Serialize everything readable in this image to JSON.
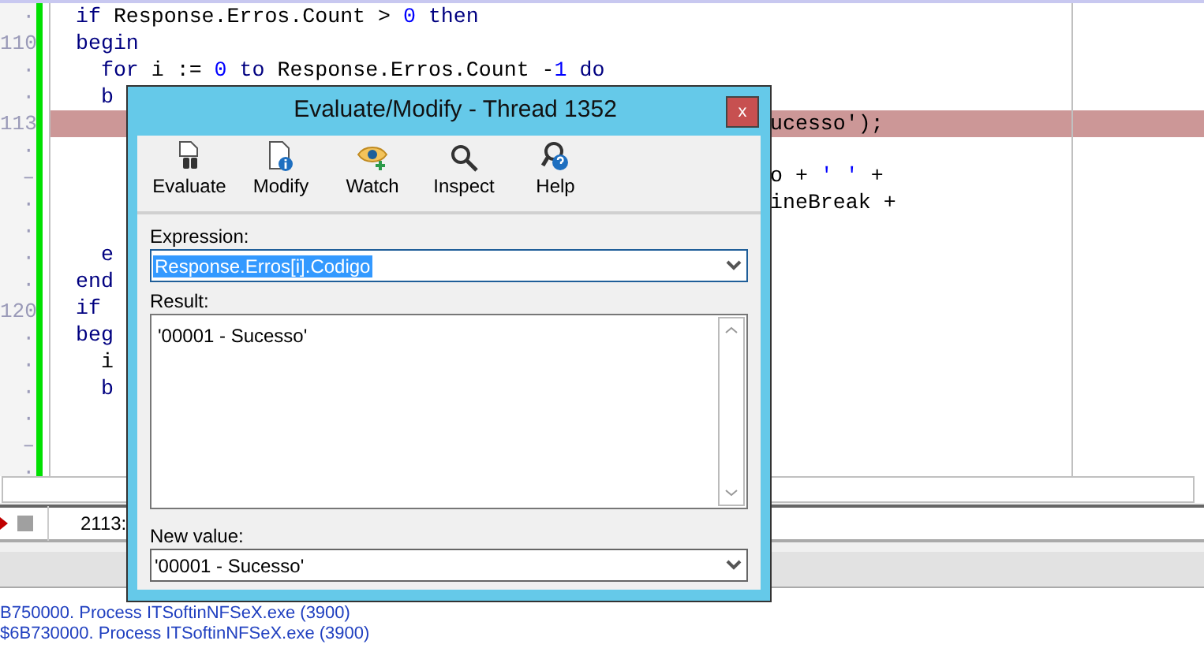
{
  "editor": {
    "lines": [
      {
        "gutter": "·",
        "highlighted": false,
        "left": [
          {
            "kind": "keyword",
            "text": "if"
          },
          {
            "kind": "plain",
            "text": " Response.Erros.Count > "
          },
          {
            "kind": "number",
            "text": "0"
          },
          {
            "kind": "keyword",
            "text": " then"
          }
        ]
      },
      {
        "gutter": "110",
        "highlighted": false,
        "left": [
          {
            "kind": "keyword",
            "text": "begin"
          }
        ]
      },
      {
        "gutter": "·",
        "highlighted": false,
        "left": [
          {
            "kind": "keyword",
            "text": "  for"
          },
          {
            "kind": "plain",
            "text": " i := "
          },
          {
            "kind": "number",
            "text": "0"
          },
          {
            "kind": "keyword",
            "text": " to"
          },
          {
            "kind": "plain",
            "text": " Response.Erros.Count -"
          },
          {
            "kind": "number",
            "text": "1"
          },
          {
            "kind": "keyword",
            "text": " do"
          }
        ]
      },
      {
        "gutter": "·",
        "highlighted": false,
        "left": [
          {
            "kind": "keyword",
            "text": "  b"
          }
        ]
      },
      {
        "gutter": "113",
        "highlighted": true,
        "right": [
          {
            "kind": "plain",
            "text": "ucesso');"
          }
        ]
      },
      {
        "gutter": "·",
        "highlighted": false
      },
      {
        "gutter": "–",
        "highlighted": false,
        "right": [
          {
            "kind": "plain",
            "text": "o + "
          },
          {
            "kind": "string",
            "text": "' '"
          },
          {
            "kind": "plain",
            "text": " +"
          }
        ]
      },
      {
        "gutter": "·",
        "highlighted": false,
        "right": [
          {
            "kind": "plain",
            "text": "ineBreak +"
          }
        ]
      },
      {
        "gutter": "·",
        "highlighted": false
      },
      {
        "gutter": "·",
        "highlighted": false,
        "left": [
          {
            "kind": "keyword",
            "text": "  e"
          }
        ]
      },
      {
        "gutter": "·",
        "highlighted": false,
        "left": [
          {
            "kind": "keyword",
            "text": "end"
          }
        ]
      },
      {
        "gutter": "120",
        "highlighted": false,
        "left": [
          {
            "kind": "keyword",
            "text": "if"
          }
        ]
      },
      {
        "gutter": "·",
        "highlighted": false,
        "left": [
          {
            "kind": "keyword",
            "text": "beg"
          }
        ]
      },
      {
        "gutter": "·",
        "highlighted": false,
        "left": [
          {
            "kind": "plain",
            "text": "  i"
          }
        ]
      },
      {
        "gutter": "·",
        "highlighted": false,
        "left": [
          {
            "kind": "keyword",
            "text": "  b"
          }
        ]
      },
      {
        "gutter": "·",
        "highlighted": false
      },
      {
        "gutter": "–",
        "highlighted": false
      },
      {
        "gutter": "·",
        "highlighted": false
      }
    ]
  },
  "status": {
    "position": "2113:"
  },
  "messages": [
    "B750000. Process ITSoftinNFSeX.exe (3900)",
    "$6B730000. Process ITSoftinNFSeX.exe (3900)"
  ],
  "dialog": {
    "title": "Evaluate/Modify - Thread 1352",
    "close": "x",
    "toolbar": [
      {
        "kind": "evaluate",
        "label": "Evaluate"
      },
      {
        "kind": "modify",
        "label": "Modify"
      },
      {
        "kind": "watch",
        "label": "Watch"
      },
      {
        "kind": "inspect",
        "label": "Inspect"
      },
      {
        "kind": "help",
        "label": "Help"
      }
    ],
    "expression": {
      "label": "Expression:",
      "value": "Response.Erros[i].Codigo"
    },
    "result": {
      "label": "Result:",
      "value": "'00001 - Sucesso'"
    },
    "new_value": {
      "label": "New value:",
      "value": "'00001 - Sucesso'"
    }
  }
}
